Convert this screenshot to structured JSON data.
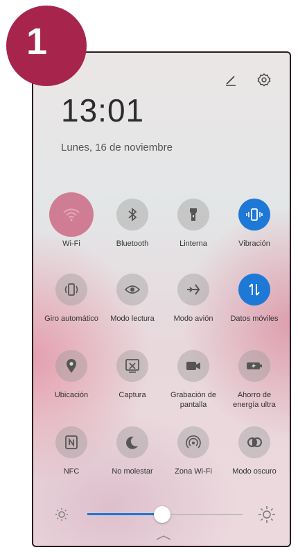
{
  "step": {
    "number": "1"
  },
  "header": {
    "time": "13:01",
    "date": "Lunes, 16 de noviembre"
  },
  "tiles": [
    {
      "label": "Wi-Fi",
      "icon": "wifi-icon",
      "state": "on"
    },
    {
      "label": "Bluetooth",
      "icon": "bluetooth-icon",
      "state": "off"
    },
    {
      "label": "Linterna",
      "icon": "flashlight-icon",
      "state": "off"
    },
    {
      "label": "Vibración",
      "icon": "vibration-icon",
      "state": "on"
    },
    {
      "label": "Giro automático",
      "icon": "auto-rotate-icon",
      "state": "off"
    },
    {
      "label": "Modo lectura",
      "icon": "eye-icon",
      "state": "off"
    },
    {
      "label": "Modo avión",
      "icon": "airplane-icon",
      "state": "off"
    },
    {
      "label": "Datos móviles",
      "icon": "mobile-data-icon",
      "state": "on"
    },
    {
      "label": "Ubicación",
      "icon": "location-icon",
      "state": "off"
    },
    {
      "label": "Captura",
      "icon": "screenshot-icon",
      "state": "off"
    },
    {
      "label": "Grabación de pantalla",
      "icon": "screen-record-icon",
      "state": "off"
    },
    {
      "label": "Ahorro de energía ultra",
      "icon": "battery-saver-icon",
      "state": "off"
    },
    {
      "label": "NFC",
      "icon": "nfc-icon",
      "state": "off"
    },
    {
      "label": "No molestar",
      "icon": "moon-icon",
      "state": "off"
    },
    {
      "label": "Zona Wi-Fi",
      "icon": "hotspot-icon",
      "state": "off"
    },
    {
      "label": "Modo oscuro",
      "icon": "dark-mode-icon",
      "state": "off"
    }
  ],
  "brightness": {
    "level": 0.48
  },
  "colors": {
    "badge": "#a7244c",
    "accent": "#1e78d6",
    "wifi_active": "#c85a78"
  }
}
